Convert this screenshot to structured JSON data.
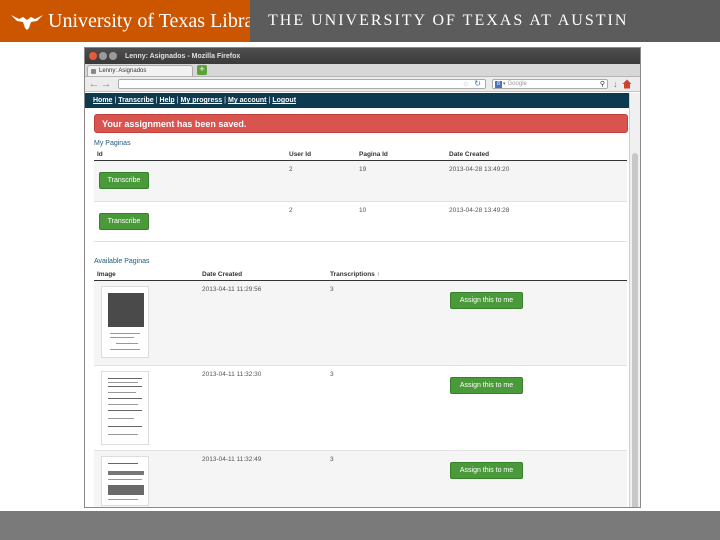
{
  "slide": {
    "brand_title": "University of Texas Libraries",
    "ut_title": "THE UNIVERSITY OF TEXAS AT AUSTIN",
    "colors": {
      "brand": "#cc5500",
      "bar": "#5c5c5c",
      "nav": "#0d3a4f",
      "alert": "#d9534f",
      "button": "#4a9a3b"
    }
  },
  "browser": {
    "window_title": "Lenny: Asignados - Mozilla Firefox",
    "tab_label": "Lenny: Asignados",
    "search_placeholder": "Google",
    "search_badge": "8",
    "icons": [
      "back-arrow-icon",
      "forward-arrow-icon",
      "star-icon",
      "reload-icon",
      "search-icon",
      "download-icon",
      "home-icon"
    ]
  },
  "app": {
    "nav": [
      "Home",
      "Transcribe",
      "Help",
      "My progress",
      "My account",
      "Logout"
    ],
    "alert": "Your assignment has been saved.",
    "my_paginas": {
      "title": "My Paginas",
      "headers": [
        "Id",
        "User Id",
        "Pagina Id",
        "Date Created"
      ],
      "rows": [
        {
          "action": "Transcribe",
          "user_id": "2",
          "pagina_id": "19",
          "date_created": "2013-04-28 13:49:20"
        },
        {
          "action": "Transcribe",
          "user_id": "2",
          "pagina_id": "10",
          "date_created": "2013-04-28 13:49:28"
        }
      ]
    },
    "available_paginas": {
      "title": "Available Paginas",
      "headers": [
        "Image",
        "Date Created",
        "Transcriptions"
      ],
      "sort_indicator": "↑",
      "rows": [
        {
          "date_created": "2013-04-11 11:29:56",
          "transcriptions": "3",
          "action": "Assign this to me"
        },
        {
          "date_created": "2013-04-11 11:32:30",
          "transcriptions": "3",
          "action": "Assign this to me"
        },
        {
          "date_created": "2013-04-11 11:32:49",
          "transcriptions": "3",
          "action": "Assign this to me"
        }
      ]
    }
  }
}
